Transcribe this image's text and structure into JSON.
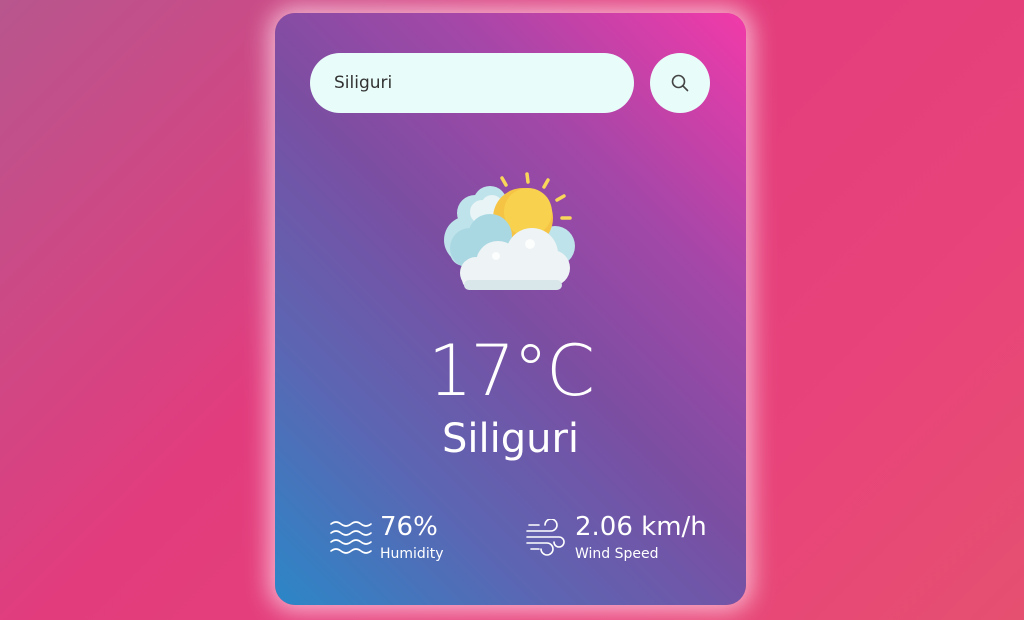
{
  "search": {
    "value": "Siliguri",
    "button_icon": "search-icon"
  },
  "weather": {
    "icon": "sun-behind-clouds-icon",
    "temperature": "17°C",
    "city": "Siliguri"
  },
  "details": {
    "humidity": {
      "icon": "water-waves-icon",
      "value": "76%",
      "label": "Humidity"
    },
    "wind": {
      "icon": "wind-icon",
      "value": "2.06 km/h",
      "label": "Wind Speed"
    }
  },
  "colors": {
    "card_gradient": [
      "#f23aa9",
      "#7b4ea2",
      "#2b87c7"
    ],
    "input_background": "#e8fcf9",
    "text": "#ffffff"
  }
}
